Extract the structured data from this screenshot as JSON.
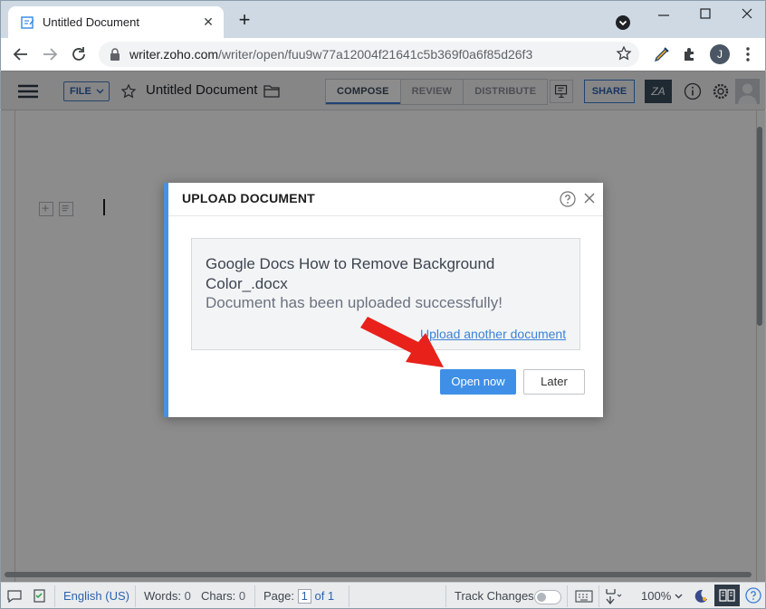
{
  "browser": {
    "tab_title": "Untitled Document",
    "url_host": "writer.zoho.com",
    "url_path": "/writer/open/fuu9w77a12004f21641c5b369f0a6f85d26f3",
    "profile_initial": "J"
  },
  "toolbar": {
    "file_label": "FILE",
    "document_title": "Untitled Document",
    "modes": [
      "COMPOSE",
      "REVIEW",
      "DISTRIBUTE"
    ],
    "active_mode": "COMPOSE",
    "share_label": "SHARE",
    "za_label": "ZA"
  },
  "dialog": {
    "title": "UPLOAD DOCUMENT",
    "file_name": "Google Docs How to Remove Background Color_.docx",
    "message": "Document has been uploaded successfully!",
    "upload_another": "Upload another document",
    "open_now": "Open now",
    "later": "Later"
  },
  "statusbar": {
    "language": "English (US)",
    "words_label": "Words:",
    "words_value": "0",
    "chars_label": "Chars:",
    "chars_value": "0",
    "page_label": "Page:",
    "page_current": "1",
    "page_total": "of 1",
    "track_changes": "Track Changes",
    "zoom": "100%"
  },
  "colors": {
    "accent": "#3f8fe6",
    "arrow": "#e8211a",
    "dialog_border": "#4a90e2"
  }
}
